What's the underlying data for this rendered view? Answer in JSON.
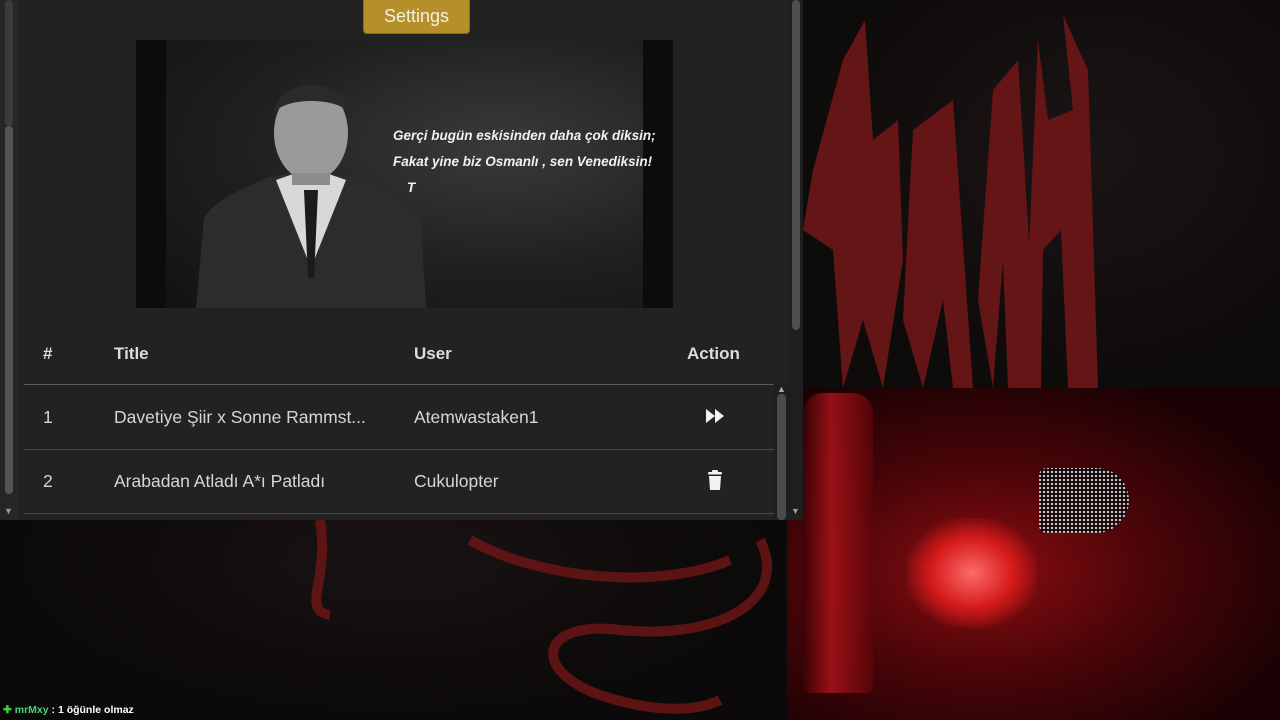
{
  "settings": {
    "label": "Settings"
  },
  "video": {
    "quote_lines": [
      "Gerçi bugün eskisinden daha çok diksin;",
      "Fakat yine biz Osmanlı , sen Venediksin!",
      "T"
    ]
  },
  "table": {
    "headers": {
      "index": "#",
      "title": "Title",
      "user": "User",
      "action": "Action"
    },
    "rows": [
      {
        "index": "1",
        "title": "Davetiye Şiir x Sonne Rammst...",
        "user": "Atemwastaken1",
        "action_icon": "skip-forward-icon"
      },
      {
        "index": "2",
        "title": "Arabadan Atladı A*ı Patladı",
        "user": "Cukulopter",
        "action_icon": "trash-icon"
      }
    ]
  },
  "chat": {
    "plus": "✚",
    "username": "mrMxy",
    "separator": " : ",
    "message": "1 öğünle olmaz"
  },
  "colors": {
    "settings_button": "#b5902a",
    "panel": "#222222",
    "chat_user": "#49d27a"
  }
}
